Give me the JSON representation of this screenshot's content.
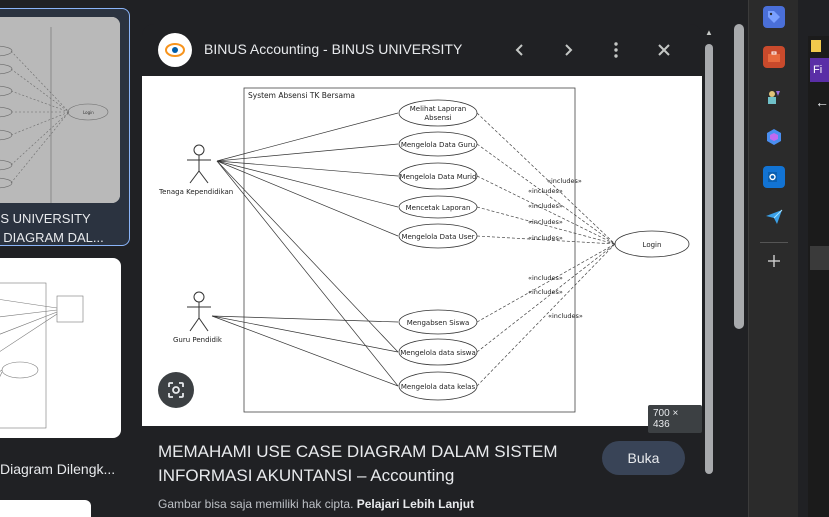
{
  "results": [
    {
      "title_line1": "US UNIVERSITY",
      "title_line2": "E DIAGRAM DAL..."
    },
    {
      "title": "Diagram Dilengk..."
    }
  ],
  "panel": {
    "site_name": "BINUS Accounting - BINUS UNIVERSITY",
    "image_dims": "700 × 436",
    "caption": "MEMAHAMI USE CASE DIAGRAM DALAM SISTEM INFORMASI AKUNTANSI – Accounting",
    "open_label": "Buka",
    "copyright_text": "Gambar bisa saja memiliki hak cipta.",
    "learn_more": "Pelajari Lebih Lanjut"
  },
  "diagram": {
    "system_title": "System Absensi TK Bersama",
    "actor1": "Tenaga Kependidikan",
    "actor2": "Guru Pendidik",
    "login": "Login",
    "uc1a": "Melihat Laporan",
    "uc1b": "Absensi",
    "uc2": "Mengelola Data Guru",
    "uc3": "Mengelola Data Murid",
    "uc4": "Mencetak Laporan",
    "uc5": "Mengelola Data User",
    "uc6": "Mengabsen Siswa",
    "uc7": "Mengelola data siswa",
    "uc8": "Mengelola data kelas",
    "include": "«includes»"
  },
  "edge_sidebar": {
    "icons": [
      "tag-icon",
      "toolbox-icon",
      "games-icon",
      "copilot-icon",
      "outlook-icon",
      "send-icon",
      "add-icon"
    ]
  },
  "far_right": {
    "tab_text": "Fi"
  }
}
